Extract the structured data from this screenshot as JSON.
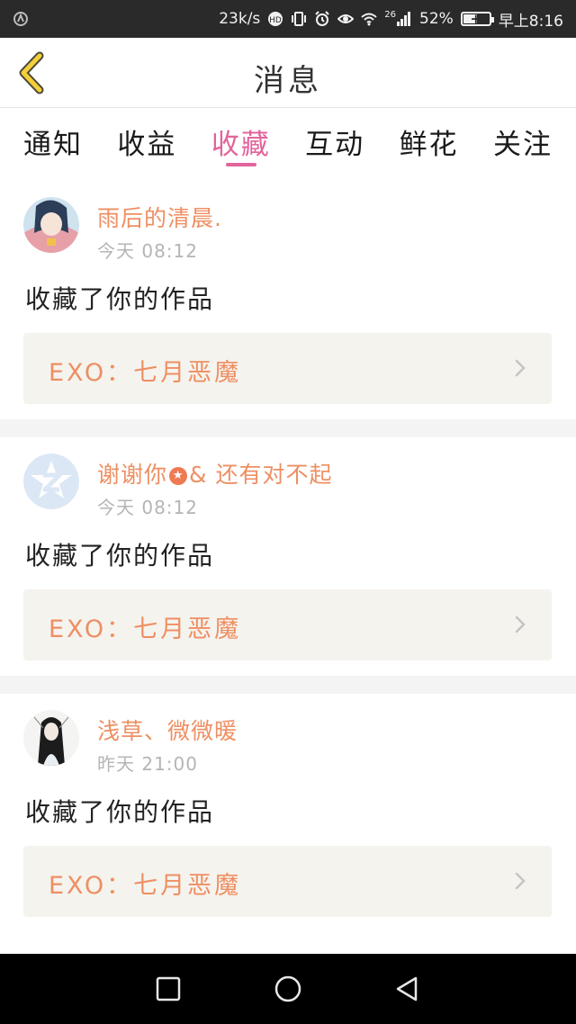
{
  "status_bar": {
    "net_speed": "23k/s",
    "network": "26",
    "battery": "52%",
    "battery_level": 0.52,
    "time": "早上8:16"
  },
  "header": {
    "title": "消息"
  },
  "tabs": [
    {
      "label": "通知",
      "active": false
    },
    {
      "label": "收益",
      "active": false
    },
    {
      "label": "收藏",
      "active": true
    },
    {
      "label": "互动",
      "active": false
    },
    {
      "label": "鲜花",
      "active": false
    },
    {
      "label": "关注",
      "active": false
    }
  ],
  "messages": [
    {
      "user": "雨后的清晨.",
      "time": "今天  08:12",
      "text": "收藏了你的作品",
      "work": "EXO：七月恶魔"
    },
    {
      "user_prefix": "谢谢你",
      "user_suffix": "& 还有对不起",
      "time": "今天  08:12",
      "text": "收藏了你的作品",
      "work": "EXO：七月恶魔"
    },
    {
      "user": "浅草、微微暖",
      "time": "昨天  21:00",
      "text": "收藏了你的作品",
      "work": "EXO：七月恶魔"
    }
  ],
  "colors": {
    "accent": "#e2649b",
    "name": "#ee8f63",
    "card_bg": "#f5f3ee"
  }
}
